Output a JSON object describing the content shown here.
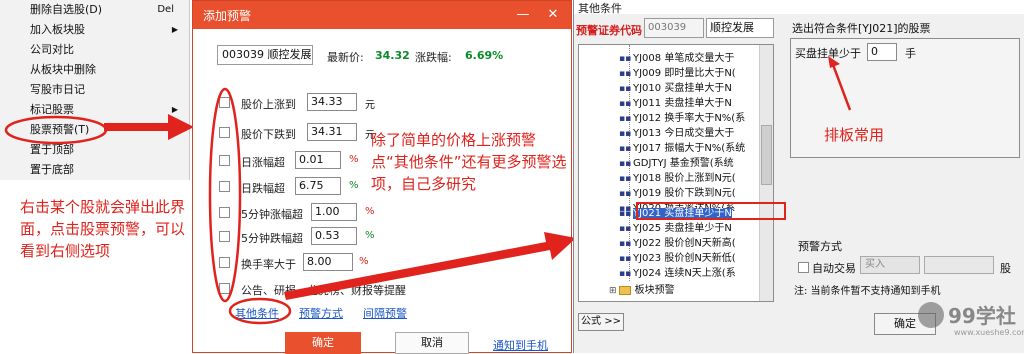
{
  "context_menu": {
    "items": [
      {
        "label": "删除自选股(D)",
        "shortcut": "Del"
      },
      {
        "label": "加入板块股",
        "arrow": "▶"
      },
      {
        "label": "公司对比"
      },
      {
        "label": "从板块中删除"
      },
      {
        "label": "写股市日记"
      },
      {
        "label": "标记股票",
        "arrow": "▶"
      },
      {
        "label": "股票预警(T)"
      },
      {
        "label": "置于顶部"
      },
      {
        "label": "置于底部"
      }
    ],
    "annotation": "右击某个股就会弹出此界面，点击股票预警，可以看到右侧选项"
  },
  "alert_dialog": {
    "title": "添加预警",
    "stock": "003039 顺控发展",
    "latest_price_label": "最新价:",
    "latest_price": "34.32",
    "change_label": "涨跌幅:",
    "change": "6.69%",
    "conditions": [
      {
        "label": "股价上涨到",
        "value": "34.33",
        "unit": "元"
      },
      {
        "label": "股价下跌到",
        "value": "34.31",
        "unit": "元"
      },
      {
        "label": "日涨幅超",
        "value": "0.01",
        "unit": "%"
      },
      {
        "label": "日跌幅超",
        "value": "6.75",
        "unit": "%"
      },
      {
        "label": "5分钟涨幅超",
        "value": "1.00",
        "unit": "%"
      },
      {
        "label": "5分钟跌幅超",
        "value": "0.53",
        "unit": "%"
      },
      {
        "label": "换手率大于",
        "value": "8.00",
        "unit": "%"
      }
    ],
    "extra_row": "公告、研报、龙虎榜、财报等提醒",
    "links": {
      "other": "其他条件",
      "method": "预警方式",
      "interval": "间隔预警"
    },
    "ok": "确定",
    "cancel": "取消",
    "notify": "通知到手机",
    "annotation": "除了简单的价格上涨预警点“其他条件”还有更多预警选项，自己多研究"
  },
  "other_dialog": {
    "title": "其他条件",
    "code_label": "预警证券代码",
    "code": "003039",
    "name": "顺控发展",
    "tree_items": [
      "YJ008 单笔成交量大于",
      "YJ009 即时量比大于N(",
      "YJ010 买盘挂单大于N",
      "YJ011 卖盘挂单大于N",
      "YJ012 换手率大于N%(系",
      "YJ013 今日成交量大于",
      "YJ017 振幅大于N%(系统",
      "GDJTYJ 基金预警(系统",
      "YJ018 股价上涨到N元(",
      "YJ019 股价下跌到N元(",
      "YJ020 换手率达N%(系",
      "YJ021 买盘挂单少于N",
      "YJ025 卖盘挂单少于N",
      "YJ022 股价创N天新高(",
      "YJ023 股价创N天新低(",
      "YJ024 连续N天上涨(系"
    ],
    "folder": "板块预警",
    "right_title": "选出符合条件[YJ021]的股票",
    "param_label": "买盘挂单少于",
    "param_value": "0",
    "param_unit": "手",
    "annotation": "排板常用",
    "warn_header": "预警方式",
    "auto_trade": "自动交易",
    "buy": "买入",
    "share_unit": "股",
    "note": "注: 当前条件暂不支持通知到手机",
    "formula": "公式 >>",
    "ok": "确定"
  },
  "logo": {
    "name": "99学社",
    "url": "www.xueshe9.com"
  }
}
